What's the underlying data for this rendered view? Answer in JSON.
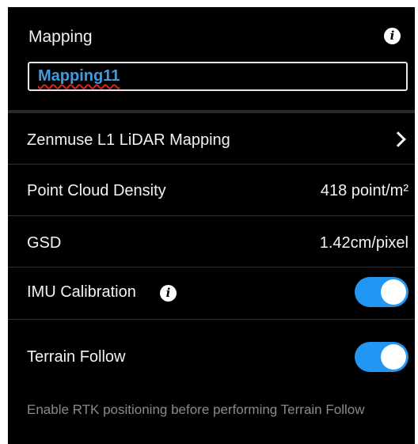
{
  "header": {
    "title": "Mapping",
    "info_icon": "info-icon",
    "name_input": {
      "value": "Mapping11"
    }
  },
  "rows": {
    "mapping_mode": {
      "label": "Zenmuse L1 LiDAR Mapping",
      "icon": "chevron-right-icon"
    },
    "point_cloud_density": {
      "label": "Point Cloud Density",
      "value": "418 point/m²"
    },
    "gsd": {
      "label": "GSD",
      "value": "1.42cm/pixel"
    },
    "imu_calibration": {
      "label": "IMU Calibration",
      "info_icon": "info-icon",
      "enabled": true
    },
    "terrain_follow": {
      "label": "Terrain Follow",
      "enabled": true
    }
  },
  "hint_text": "Enable RTK positioning before performing Terrain Follow",
  "colors": {
    "background": "#000000",
    "accent": "#2196f3",
    "link_text": "#3d9ce0",
    "spellcheck_underline": "#d9261c",
    "hint_text": "#8a8a8a"
  }
}
